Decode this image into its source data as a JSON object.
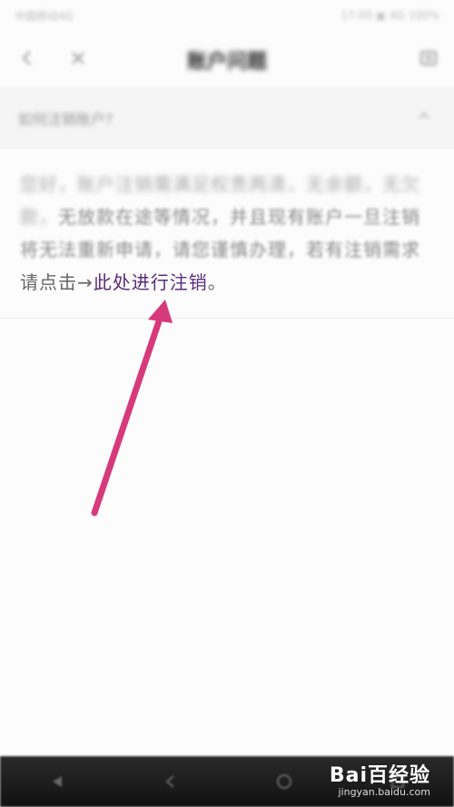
{
  "status_bar": {
    "left": "中国移动4G",
    "right": "17:00 ▣ 4G 100%"
  },
  "header": {
    "title": "账户问题"
  },
  "faq": {
    "question": "如何注销账户?"
  },
  "answer": {
    "part1": "您好，账户注销需满足权责两清，无余额，无欠款，",
    "part2": "无放款在途等情况，并且现有账户一旦注销",
    "part3": "将无法重新申请，请您谨慎办理，若有注销需求",
    "part4": "请点击→",
    "link": "此处进行注销",
    "end": "。"
  },
  "watermark": {
    "brand": "Bai百经验",
    "site": "jingyan.baidu.com"
  },
  "colors": {
    "link": "#5a2b7a",
    "arrow": "#d63a7b"
  },
  "icons": [
    "back-icon",
    "close-icon",
    "menu-icon",
    "chevron-down-icon",
    "nav-back-icon",
    "nav-home-icon",
    "nav-recent-icon",
    "nav-menu-icon"
  ]
}
